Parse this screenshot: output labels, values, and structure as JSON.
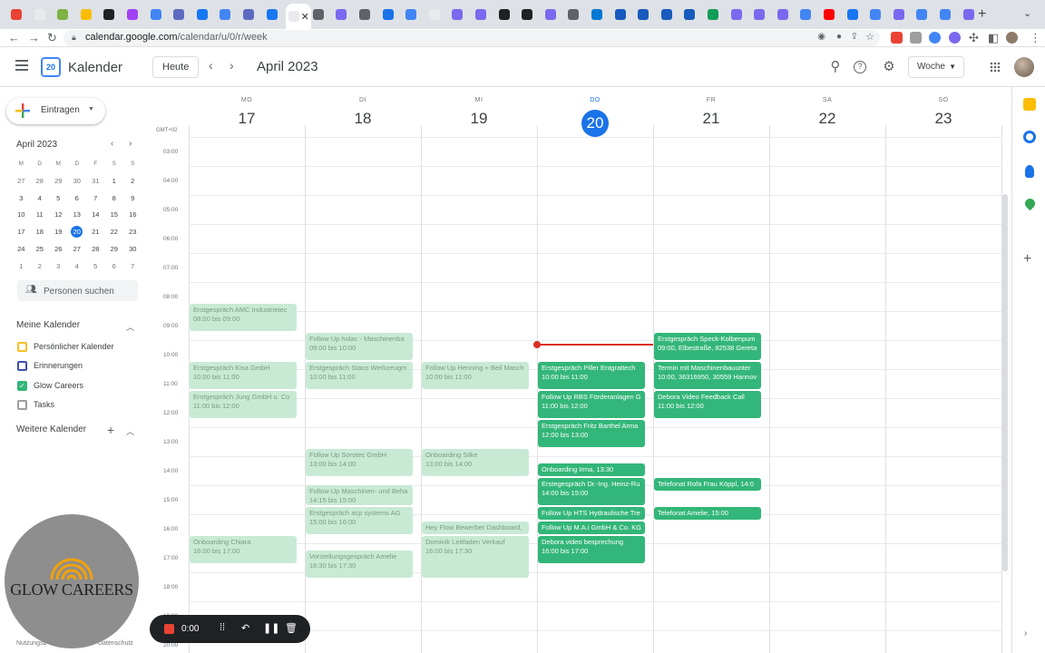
{
  "browser": {
    "url_host": "calendar.google.com",
    "url_path": "/calendar/u/0/r/week"
  },
  "tab_favicons": [
    "#ea4335",
    "#e8eaed",
    "#7cb342",
    "#fbbc04",
    "#202124",
    "#a142f4",
    "#4285f4",
    "#5c6bc0",
    "#1877f2",
    "#4285f4",
    "#5c6bc0",
    "#1877f2",
    "#e8eaed",
    "#5f6368",
    "#7b68ee",
    "#5f6368",
    "#1a73e8",
    "#4285f4",
    "#e8eaed",
    "#7b68ee",
    "#7b68ee",
    "#202124",
    "#202124",
    "#7b68ee",
    "#5f6368",
    "#0078d4",
    "#185abd",
    "#185abd",
    "#185abd",
    "#185abd",
    "#0f9d58",
    "#7b68ee",
    "#7b68ee",
    "#7b68ee",
    "#4285f4",
    "#ff0000",
    "#1877f2",
    "#4285f4",
    "#7b68ee",
    "#4285f4",
    "#4285f4",
    "#7b68ee"
  ],
  "header": {
    "app_title": "Kalender",
    "logo_day": "20",
    "today_label": "Heute",
    "month_title": "April 2023",
    "view_label": "Woche"
  },
  "sidebar": {
    "create_label": "Eintragen",
    "mini_title": "April 2023",
    "mini_dow": [
      "M",
      "D",
      "M",
      "D",
      "F",
      "S",
      "S"
    ],
    "mini_weeks": [
      [
        "27",
        "28",
        "29",
        "30",
        "31",
        "1",
        "2"
      ],
      [
        "3",
        "4",
        "5",
        "6",
        "7",
        "8",
        "9"
      ],
      [
        "10",
        "11",
        "12",
        "13",
        "14",
        "15",
        "16"
      ],
      [
        "17",
        "18",
        "19",
        "20",
        "21",
        "22",
        "23"
      ],
      [
        "24",
        "25",
        "26",
        "27",
        "28",
        "29",
        "30"
      ],
      [
        "1",
        "2",
        "3",
        "4",
        "5",
        "6",
        "7"
      ]
    ],
    "people_search": "Personen suchen",
    "my_calendars_title": "Meine Kalender",
    "calendars": [
      {
        "label": "Persönlicher Kalender",
        "color": "#f6bf26",
        "checked": false
      },
      {
        "label": "Erinnerungen",
        "color": "#3f51b5",
        "checked": false
      },
      {
        "label": "Glow Careers",
        "color": "#33b679",
        "checked": true
      },
      {
        "label": "Tasks",
        "color": "#9e9e9e",
        "checked": false
      }
    ],
    "other_calendars_title": "Weitere Kalender",
    "footer_terms": "Nutzungsb",
    "footer_privacy": "Datenschutz"
  },
  "week": {
    "gmt": "GMT+02",
    "days": [
      {
        "dow": "MO",
        "num": "17"
      },
      {
        "dow": "DI",
        "num": "18"
      },
      {
        "dow": "MI",
        "num": "19"
      },
      {
        "dow": "DO",
        "num": "20",
        "today": true
      },
      {
        "dow": "FR",
        "num": "21"
      },
      {
        "dow": "SA",
        "num": "22"
      },
      {
        "dow": "SO",
        "num": "23"
      }
    ],
    "hours": [
      "03:00",
      "04:00",
      "05:00",
      "06:00",
      "07:00",
      "08:00",
      "09:00",
      "10:00",
      "11:00",
      "12:00",
      "13:00",
      "14:00",
      "15:00",
      "16:00",
      "17:00",
      "18:00",
      "19:00",
      "20:00"
    ]
  },
  "events": [
    {
      "day": 0,
      "start": 8.0,
      "end": 9.0,
      "title": "Erstgespräch AMC Industrietec",
      "time": "08:00 bis 09:00",
      "past": true
    },
    {
      "day": 0,
      "start": 10.0,
      "end": 11.0,
      "title": "Erstgespräch Kisa GmbH",
      "time": "10:00 bis 11:00",
      "past": true
    },
    {
      "day": 0,
      "start": 11.0,
      "end": 12.0,
      "title": "Erstgespräch Jung GmbH u. Co",
      "time": "11:00 bis 12:00",
      "past": true
    },
    {
      "day": 0,
      "start": 16.0,
      "end": 17.0,
      "title": "Onboarding Chiara",
      "time": "16:00 bis 17:00",
      "past": true
    },
    {
      "day": 1,
      "start": 9.0,
      "end": 10.0,
      "title": "Follow Up holac - Maschinenba",
      "time": "09:00 bis 10:00",
      "past": true
    },
    {
      "day": 1,
      "start": 10.0,
      "end": 11.0,
      "title": "Erstgespräch Staco Werkzeugm",
      "time": "10:00 bis 11:00",
      "past": true
    },
    {
      "day": 1,
      "start": 13.0,
      "end": 14.0,
      "title": "Follow Up Sorotec GmbH",
      "time": "13:00 bis 14:00",
      "past": true
    },
    {
      "day": 1,
      "start": 14.25,
      "end": 15.0,
      "title": "Follow Up Maschinen- und Beha",
      "time": "14:15 bis 15:00",
      "past": true
    },
    {
      "day": 1,
      "start": 15.0,
      "end": 16.0,
      "title": "Erstgespräch acp systems AG",
      "time": "15:00 bis 16:00",
      "past": true
    },
    {
      "day": 1,
      "start": 16.5,
      "end": 17.5,
      "title": "Vorstellungsgespräch Amelie",
      "time": "16:30 bis 17:30",
      "past": true
    },
    {
      "day": 2,
      "start": 10.0,
      "end": 11.0,
      "title": "Follow Up Henning + Beil Masch",
      "time": "10:00 bis 11:00",
      "past": true
    },
    {
      "day": 2,
      "start": 13.0,
      "end": 14.0,
      "title": "Onboarding Silke",
      "time": "13:00 bis 14:00",
      "past": true
    },
    {
      "day": 2,
      "start": 15.5,
      "end": 16.0,
      "title": "Hey Flow Bewerber Dashboard,",
      "time": "",
      "past": true
    },
    {
      "day": 2,
      "start": 16.0,
      "end": 17.5,
      "title": "Dominik Leitfaden Verkauf",
      "time": "16:00 bis 17:30",
      "past": true
    },
    {
      "day": 3,
      "start": 10.0,
      "end": 11.0,
      "title": "Erstgespräch Piller Entgrattech",
      "time": "10:00 bis 11:00",
      "past": false
    },
    {
      "day": 3,
      "start": 11.0,
      "end": 12.0,
      "title": "Follow Up RBS Förderanlagen G",
      "time": "11:00 bis 12:00",
      "past": false
    },
    {
      "day": 3,
      "start": 12.0,
      "end": 13.0,
      "title": "Erstgespräch Fritz Barthel Arma",
      "time": "12:00 bis 13:00",
      "past": false
    },
    {
      "day": 3,
      "start": 13.5,
      "end": 14.0,
      "title": "Onboarding Irma, 13:30",
      "time": "",
      "past": false
    },
    {
      "day": 3,
      "start": 14.0,
      "end": 15.0,
      "title": "Erstegespräch Dr.-Ing. Heinz-Ru",
      "time": "14:00 bis 15:00",
      "past": false
    },
    {
      "day": 3,
      "start": 15.0,
      "end": 15.5,
      "title": "Follow Up HTS Hydraulische Tre",
      "time": "",
      "past": false
    },
    {
      "day": 3,
      "start": 15.5,
      "end": 16.0,
      "title": "Follow Up M.A.i GmbH & Co. KG",
      "time": "",
      "past": false
    },
    {
      "day": 3,
      "start": 16.0,
      "end": 17.0,
      "title": "Debora video besprechung",
      "time": "16:00 bis 17:00",
      "past": false
    },
    {
      "day": 4,
      "start": 9.0,
      "end": 10.0,
      "title": "Erstgespräch Speck-Kolbenpum",
      "time": "09:00, Elbestraße, 82538 Gereta",
      "past": false
    },
    {
      "day": 4,
      "start": 10.0,
      "end": 11.0,
      "title": "Termin mit Maschinenbauunter",
      "time": "10:00, 36316950, 30559 Hannov",
      "past": false
    },
    {
      "day": 4,
      "start": 11.0,
      "end": 12.0,
      "title": "Debora Video Feedback Call",
      "time": "11:00 bis 12:00",
      "past": false
    },
    {
      "day": 4,
      "start": 14.0,
      "end": 14.5,
      "title": "Telefonat Rofa Frau Köppl, 14:0",
      "time": "",
      "past": false
    },
    {
      "day": 4,
      "start": 15.0,
      "end": 15.5,
      "title": "Telefonat Amelie, 15:00",
      "time": "",
      "past": false
    }
  ],
  "now_time": 9.625,
  "overlay": {
    "logo_text": "GLOW CAREERS",
    "recorder_time": "0:00"
  }
}
